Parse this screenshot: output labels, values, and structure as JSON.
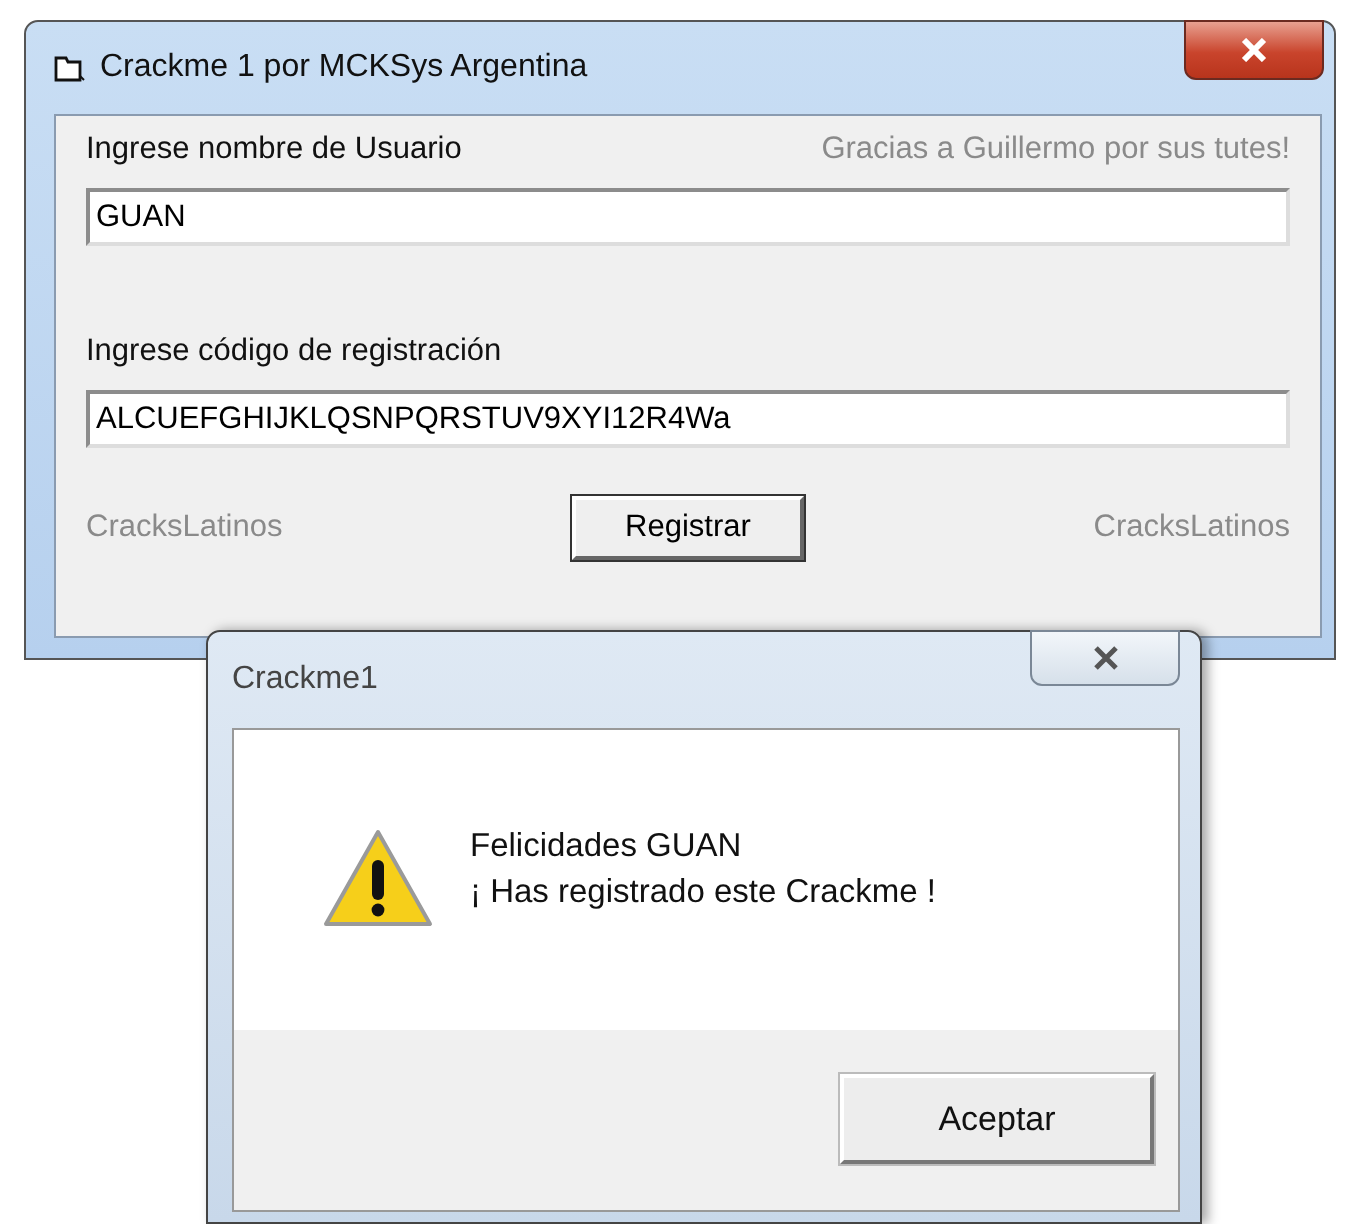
{
  "main_window": {
    "title": "Crackme 1 por MCKSys Argentina",
    "user_label": "Ingrese nombre de Usuario",
    "thanks": "Gracias a Guillermo por sus tutes!",
    "user_field": {
      "value": "GUAN"
    },
    "code_label": "Ingrese código de registración",
    "code_field": {
      "value": "ALCUEFGHIJKLQSNPQRSTUV9XYI12R4Wa"
    },
    "footer_left": "CracksLatinos",
    "register_button": "Registrar",
    "footer_right": "CracksLatinos"
  },
  "dialog": {
    "title": "Crackme1",
    "message_lines": [
      "Felicidades GUAN",
      "¡ Has registrado este Crackme !"
    ],
    "ok_button": "Aceptar"
  }
}
